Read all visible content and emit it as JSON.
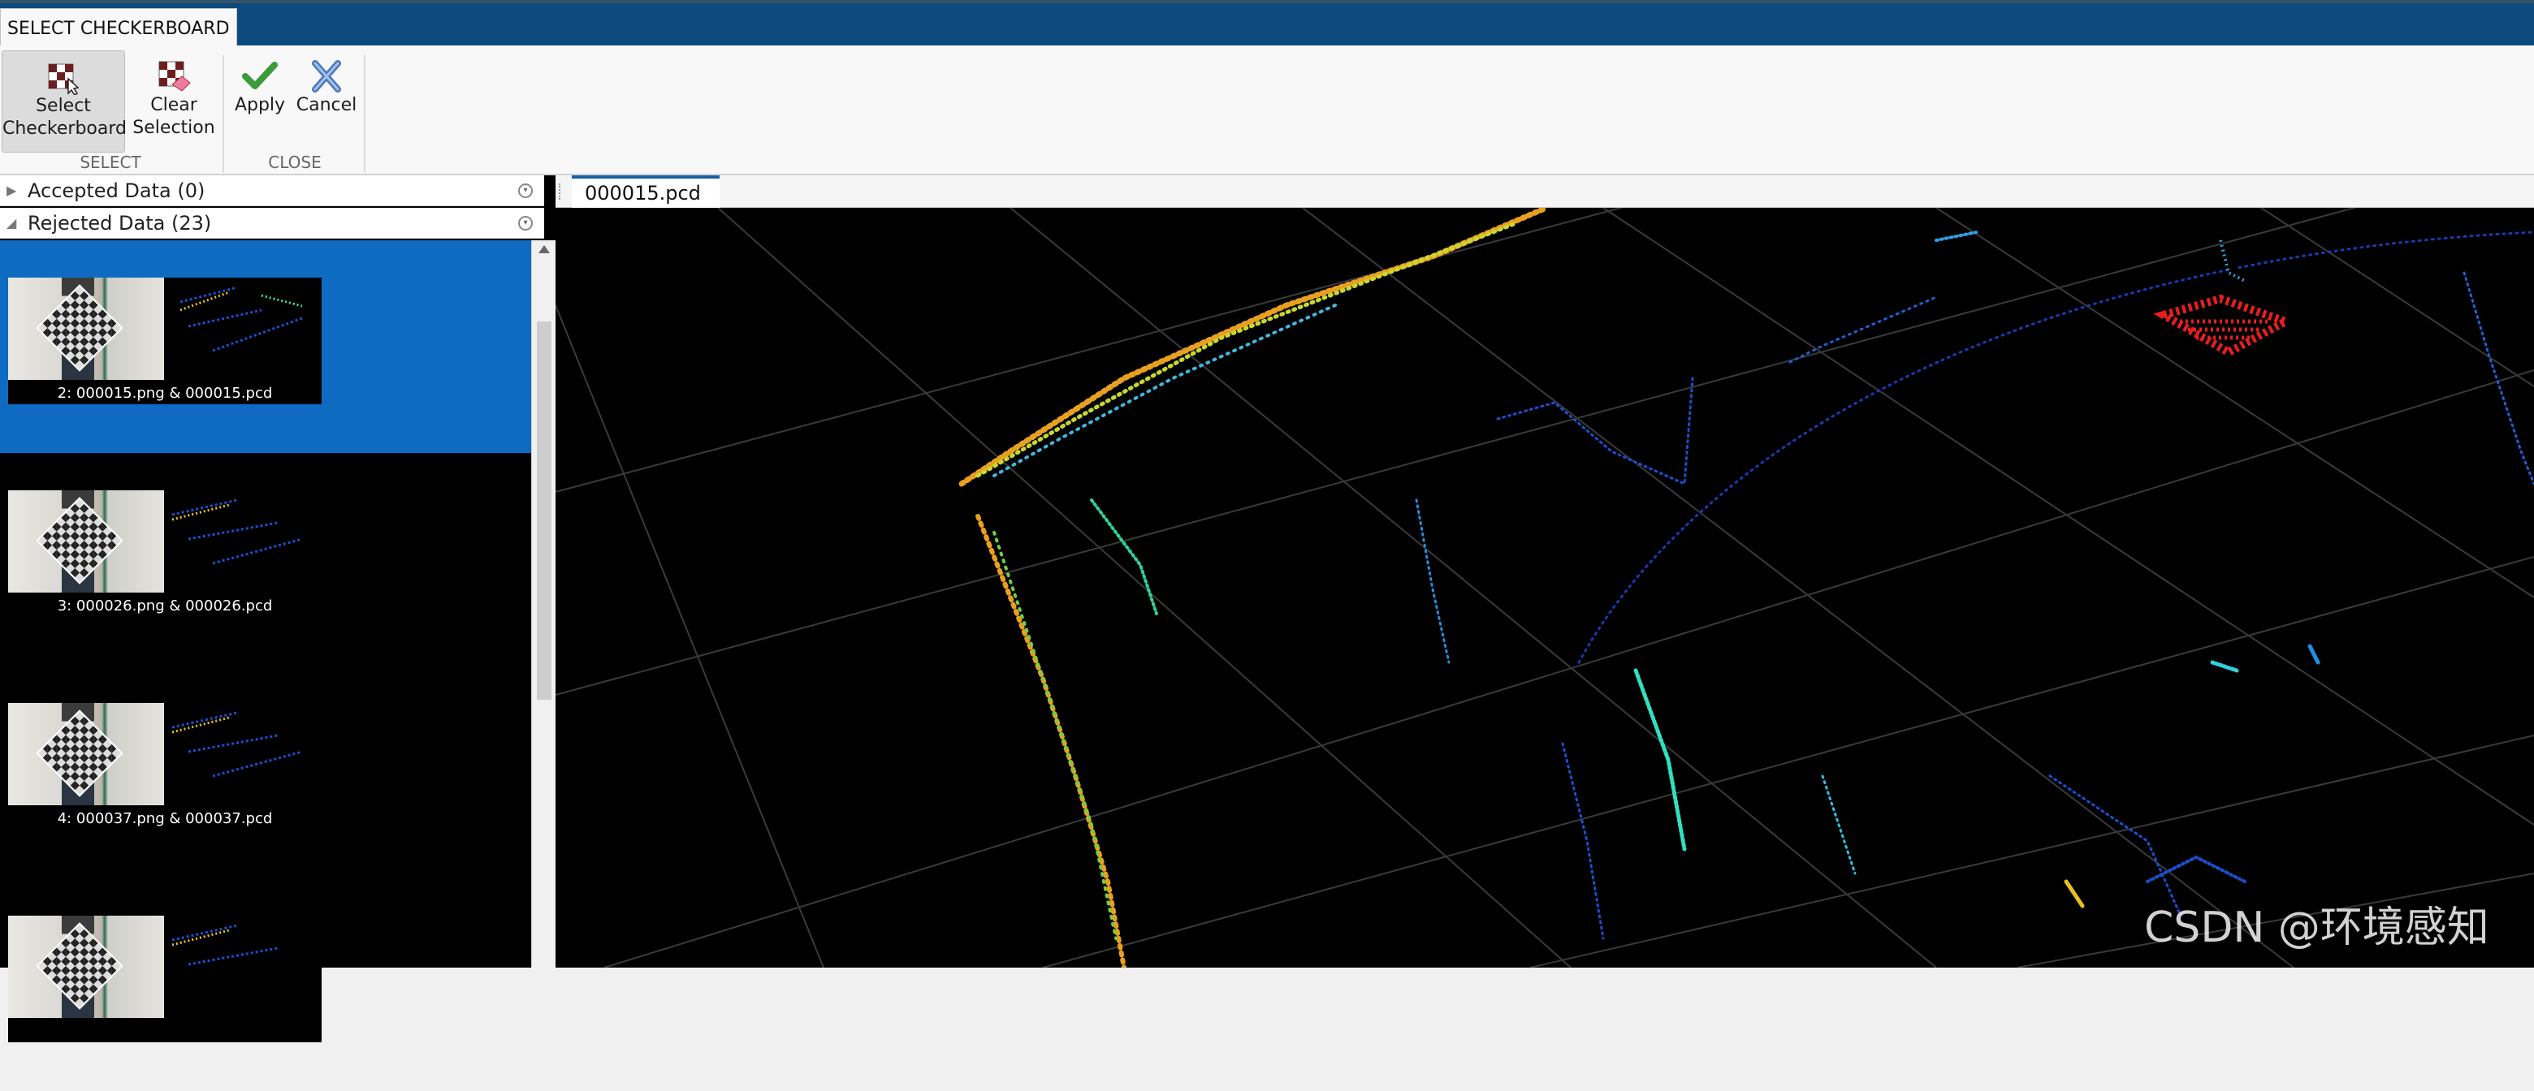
{
  "toolstrip": {
    "tab_label": "SELECT CHECKERBOARD"
  },
  "ribbon": {
    "select_group_label": "SELECT",
    "close_group_label": "CLOSE",
    "buttons": {
      "select_checkerboard": {
        "line1": "Select",
        "line2": "Checkerboard"
      },
      "clear_selection": {
        "line1": "Clear",
        "line2": "Selection"
      },
      "apply": {
        "label": "Apply"
      },
      "cancel": {
        "label": "Cancel"
      }
    }
  },
  "browser": {
    "accepted_header": "Accepted Data (0)",
    "rejected_header": "Rejected Data (23)",
    "items": [
      {
        "caption": "2: 000015.png & 000015.pcd",
        "selected": true
      },
      {
        "caption": "3: 000026.png & 000026.pcd",
        "selected": false
      },
      {
        "caption": "4: 000037.png & 000037.pcd",
        "selected": false
      },
      {
        "caption": "",
        "selected": false
      }
    ]
  },
  "view": {
    "tab_label": "000015.pcd"
  },
  "watermark": "CSDN @环境感知",
  "colors": {
    "titlebar": "#0e4a7e",
    "selected_item": "#0f6bc2",
    "checkerboard_highlight": "#e81e1e",
    "grid": "#3a3a3a"
  }
}
